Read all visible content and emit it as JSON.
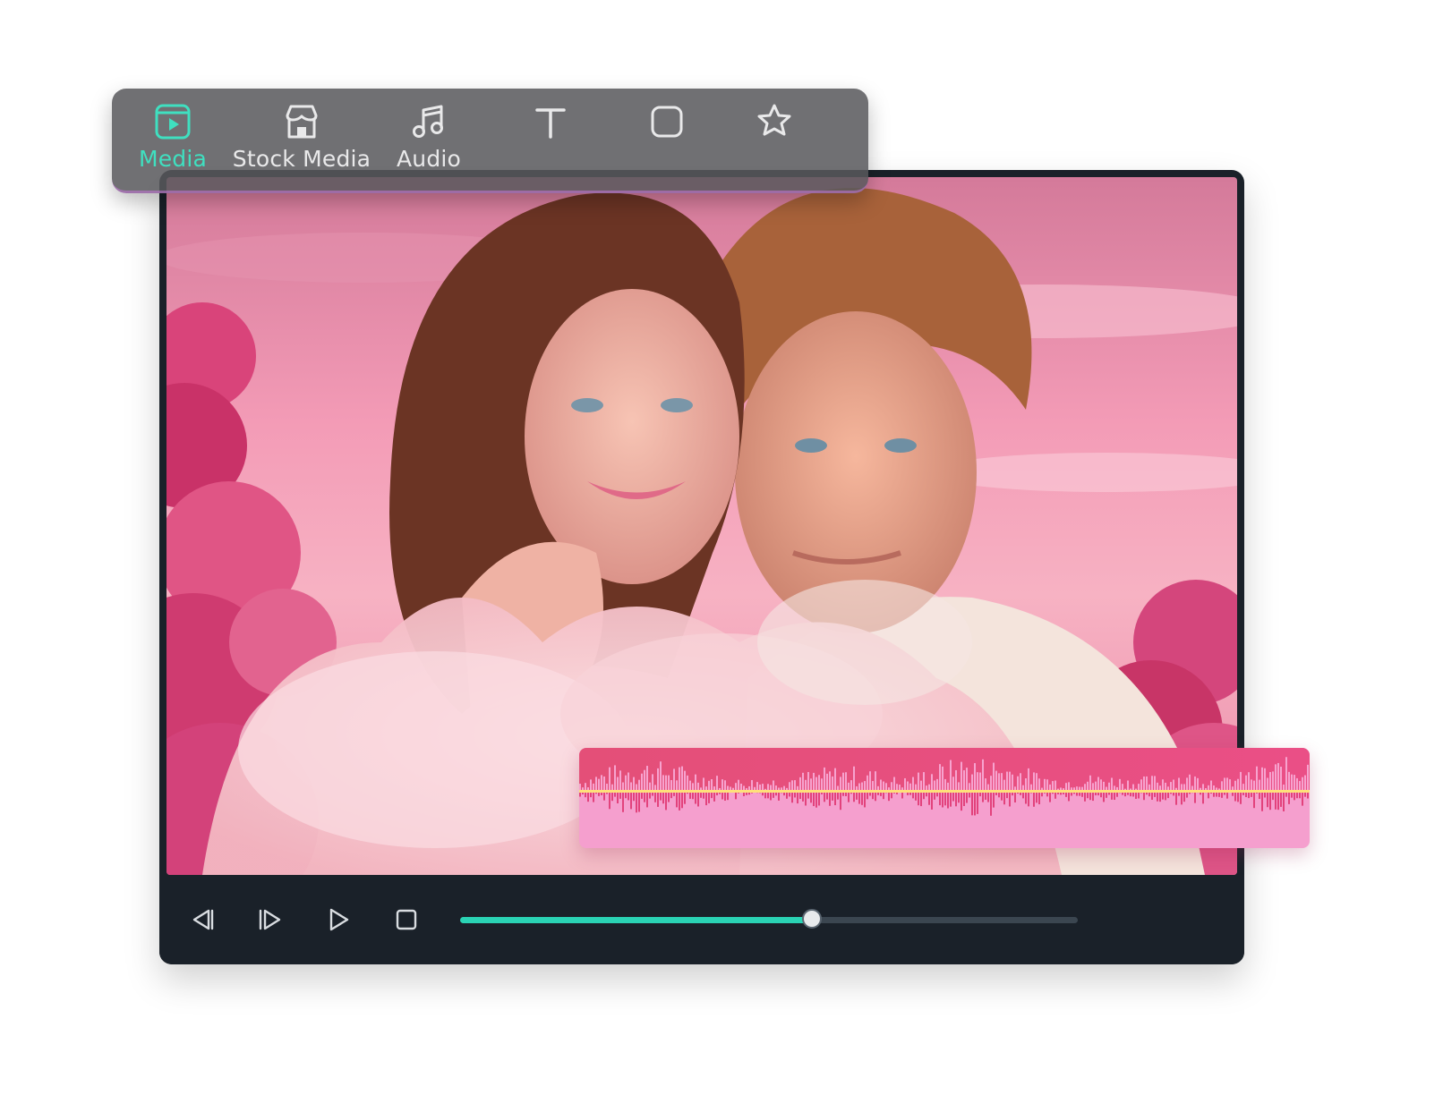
{
  "toolbar": {
    "items": [
      {
        "label": "Media",
        "icon": "media-icon",
        "active": true
      },
      {
        "label": "Stock Media",
        "icon": "stock-media-icon",
        "active": false
      },
      {
        "label": "Audio",
        "icon": "audio-icon",
        "active": false
      },
      {
        "label": "",
        "icon": "text-icon",
        "active": false
      },
      {
        "label": "",
        "icon": "sticker-icon",
        "active": false
      },
      {
        "label": "",
        "icon": "effects-icon",
        "active": false
      }
    ]
  },
  "colors": {
    "accent": "#2ad3b4",
    "active_label": "#3fe0c0",
    "player_bg": "#1a2129",
    "waveform_top": "#e44f78",
    "waveform_bottom": "#f59fce",
    "volume_line": "#ffe07a"
  },
  "playback": {
    "controls": [
      "previous-frame-icon",
      "next-frame-icon",
      "play-icon",
      "stop-icon"
    ],
    "progress_fraction": 0.57
  }
}
